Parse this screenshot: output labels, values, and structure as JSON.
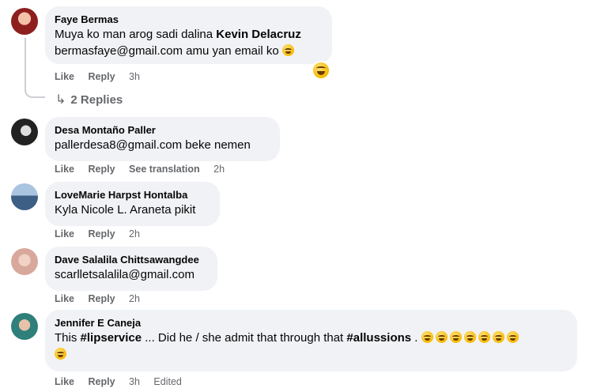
{
  "comments": [
    {
      "author": "Faye Bermas",
      "line1_text": "Muya ko man arog sadi dalina ",
      "line1_mention": "Kevin Delacruz",
      "line2_text": "bermasfaye@gmail.com amu yan email ko",
      "like": "Like",
      "reply": "Reply",
      "time": "3h",
      "replies_label": "2 Replies",
      "avatar_color": "#c0392b"
    },
    {
      "author": "Desa Montaño Paller",
      "text": "pallerdesa8@gmail.com beke nemen",
      "like": "Like",
      "reply": "Reply",
      "see_translation": "See translation",
      "time": "2h",
      "avatar_color": "#2b2b2b"
    },
    {
      "author": "LoveMarie Harpst Hontalba",
      "text": "Kyla Nicole L. Araneta pikit",
      "like": "Like",
      "reply": "Reply",
      "time": "2h",
      "avatar_color": "#5b7fa6"
    },
    {
      "author": "Dave Salalila Chittsawangdee",
      "text": "scarlletsalalila@gmail.com",
      "like": "Like",
      "reply": "Reply",
      "time": "2h",
      "avatar_color": "#d9a9a0"
    },
    {
      "author": "Jennifer E Caneja",
      "text_pre": "This ",
      "hashtag1": "#lipservice",
      "text_mid": " ... Did he / she admit that through that ",
      "hashtag2": "#allussions",
      "text_post": " .",
      "like": "Like",
      "reply": "Reply",
      "time": "3h",
      "edited": "Edited",
      "avatar_color": "#3f8f8a"
    }
  ]
}
